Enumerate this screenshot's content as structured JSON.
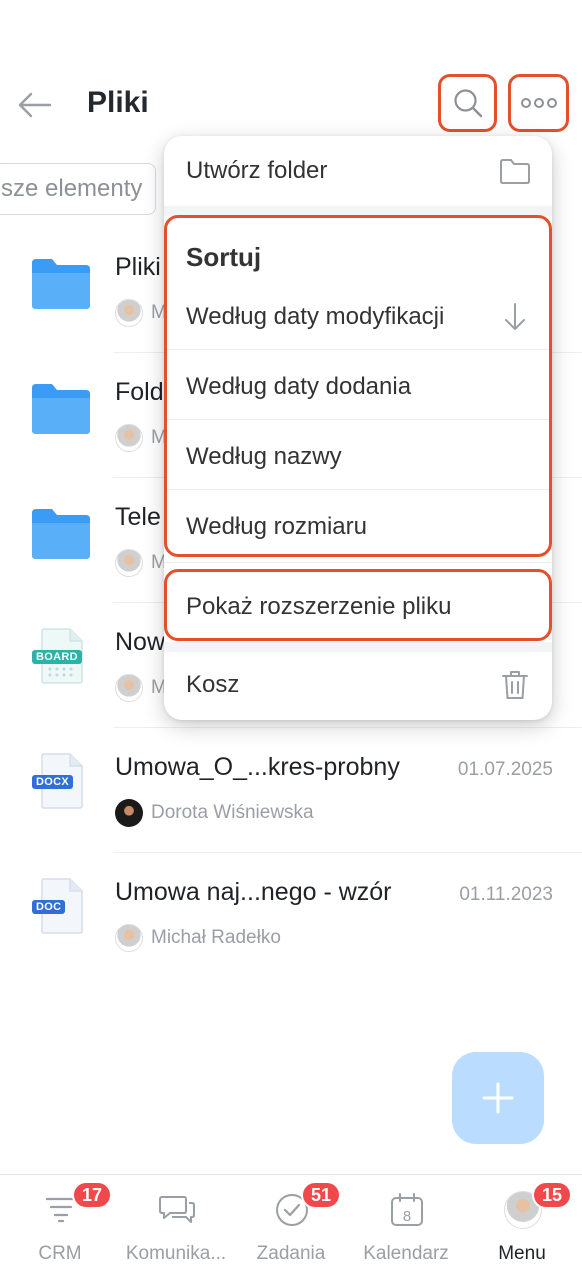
{
  "header": {
    "title": "Pliki"
  },
  "search": {
    "text": "sze elementy"
  },
  "files": [
    {
      "name": "Pliki",
      "author": "M",
      "kind": "folder"
    },
    {
      "name": "Folde",
      "author": "M",
      "kind": "folder"
    },
    {
      "name": "Tele",
      "author": "M",
      "kind": "folder"
    },
    {
      "name": "Now",
      "author": "M",
      "kind": "board",
      "badge": "BOARD"
    },
    {
      "name": "Umowa_O_...kres-probny",
      "date": "01.07.2025",
      "author": "Dorota Wiśniewska",
      "kind": "docx",
      "badge": "DOCX"
    },
    {
      "name": "Umowa naj...nego - wzór",
      "date": "01.11.2023",
      "author": "Michał Radełko",
      "kind": "doc",
      "badge": "DOC"
    }
  ],
  "menu": {
    "create_folder": "Utwórz folder",
    "sort_heading": "Sortuj",
    "sort_modified": "Według daty modyfikacji",
    "sort_added": "Według daty dodania",
    "sort_name": "Według nazwy",
    "sort_size": "Według rozmiaru",
    "show_extension": "Pokaż rozszerzenie pliku",
    "trash": "Kosz"
  },
  "nav": [
    {
      "label": "CRM",
      "badge": "17",
      "icon": "crm-icon"
    },
    {
      "label": "Komunika...",
      "icon": "chat-icon"
    },
    {
      "label": "Zadania",
      "badge": "51",
      "icon": "tasks-icon"
    },
    {
      "label": "Kalendarz",
      "icon": "calendar-icon",
      "day": "8"
    },
    {
      "label": "Menu",
      "badge": "15",
      "icon": "avatar"
    }
  ],
  "colors": {
    "accent": "#2fa4ff",
    "highlight": "#e4502a",
    "badge": "#f0484b",
    "fab": "#b9dcff"
  }
}
